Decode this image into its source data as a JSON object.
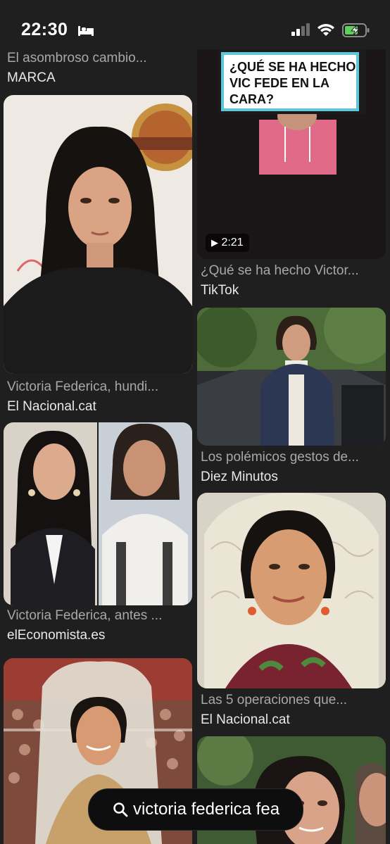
{
  "status": {
    "time": "22:30"
  },
  "search": {
    "query": "victoria federica fea"
  },
  "left_column": [
    {
      "title": "El asombroso cambio...",
      "source": "MARCA"
    },
    {
      "title": "Victoria Federica, hundi...",
      "source": "El Nacional.cat"
    },
    {
      "title": "Victoria Federica, antes ...",
      "source": "elEconomista.es"
    },
    {
      "title": "",
      "source": ""
    }
  ],
  "right_column": [
    {
      "title": "¿Qué se ha hecho Victor...",
      "source": "TikTok",
      "overlay_text": "¿QUÉ SE HA HECHO VIC FEDE EN LA CARA?",
      "duration": "2:21"
    },
    {
      "title": "Los polémicos gestos de...",
      "source": "Diez Minutos"
    },
    {
      "title": "Las 5 operaciones que...",
      "source": "El Nacional.cat"
    },
    {
      "title": "",
      "source": ""
    }
  ],
  "colors": {
    "background": "#1f1f1f",
    "caption_title": "#a8a8a8",
    "caption_source": "#e8e8e8"
  }
}
